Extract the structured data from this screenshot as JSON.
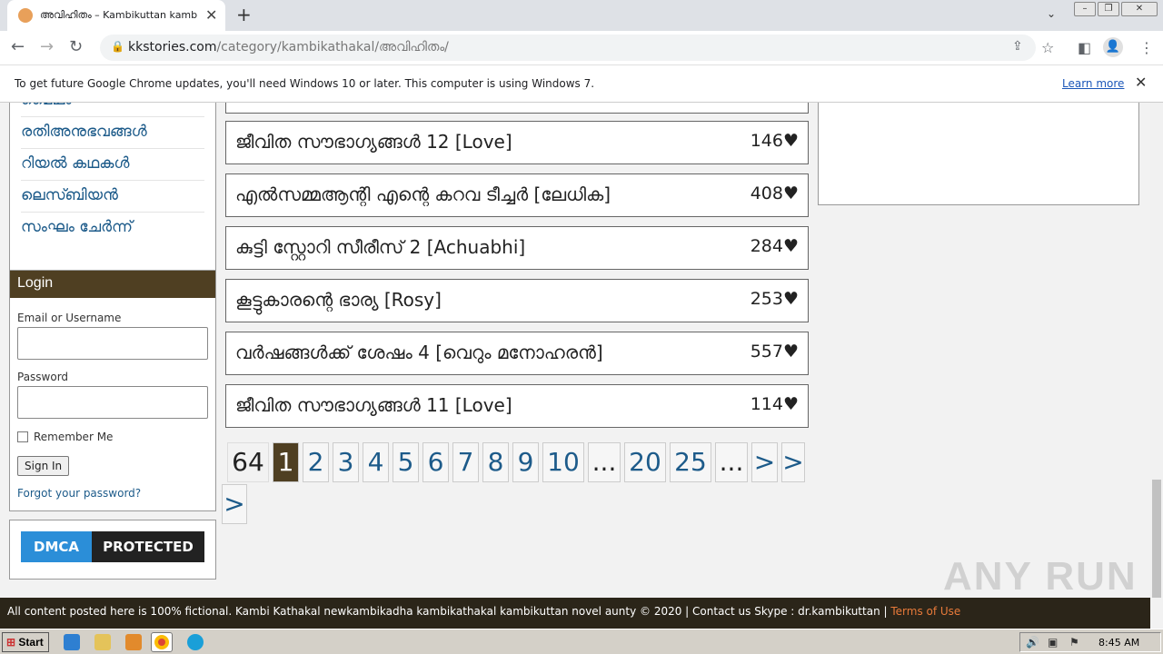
{
  "browser": {
    "tab_title": "അവിഹിതം – Kambikuttan kambi",
    "url_domain": "kkstories.com",
    "url_path": "/category/kambikathakal/അവിഹിതം/",
    "infobar_message": "To get future Google Chrome updates, you'll need Windows 10 or later. This computer is using Windows 7.",
    "infobar_link": "Learn more"
  },
  "sidebar": {
    "categories": [
      {
        "label": "മൈഥം"
      },
      {
        "label": "രതിഅനുഭവങ്ങൾ"
      },
      {
        "label": "റിയൽ കഥകൾ"
      },
      {
        "label": "ലെസ്ബിയൻ"
      },
      {
        "label": "സംഘം ചേർന്ന്"
      }
    ],
    "login": {
      "title": "Login",
      "username_label": "Email or Username",
      "password_label": "Password",
      "remember_label": "Remember Me",
      "signin_label": "Sign In",
      "forgot_label": "Forgot your password?"
    },
    "dmca": {
      "left": "DMCA",
      "right": "PROTECTED"
    }
  },
  "stories": [
    {
      "title": "ജീവിത സൗഭാഗ്യങ്ങൾ 12 [Love]",
      "likes": "146"
    },
    {
      "title": "എൽസമ്മആന്റി എന്റെ കറവ ടീച്ചർ [ലേധിക]",
      "likes": "408"
    },
    {
      "title": "കുട്ടി സ്റ്റോറി സീരീസ് 2 [Achuabhi]",
      "likes": "284"
    },
    {
      "title": "കൂട്ടുകാരന്റെ ഭാര്യ [Rosy]",
      "likes": "253"
    },
    {
      "title": "വർഷങ്ങൾക്ക് ശേഷം 4 [വെറും മനോഹരൻ]",
      "likes": "557"
    },
    {
      "title": "ജീവിത സൗഭാഗ്യങ്ങൾ 11 [Love]",
      "likes": "114"
    }
  ],
  "heart_glyph": "♥",
  "pagination": {
    "total": "64",
    "pages": [
      "1",
      "2",
      "3",
      "4",
      "5",
      "6",
      "7",
      "8",
      "9",
      "10",
      "...",
      "20",
      "25",
      "...",
      ">",
      ">",
      ">"
    ]
  },
  "footer": {
    "text": "All content posted here is 100% fictional. Kambi Kathakal newkambikadha kambikathakal kambikuttan novel aunty © 2020 | Contact us Skype : dr.kambikuttan | ",
    "tos": "Terms of Use"
  },
  "watermark": "ANY RUN",
  "taskbar": {
    "start_label": "Start",
    "clock": "8:45 AM"
  },
  "colors": {
    "accent": "#4f3f22",
    "link": "#1d5b8a",
    "footer_bg": "#2b2519"
  }
}
